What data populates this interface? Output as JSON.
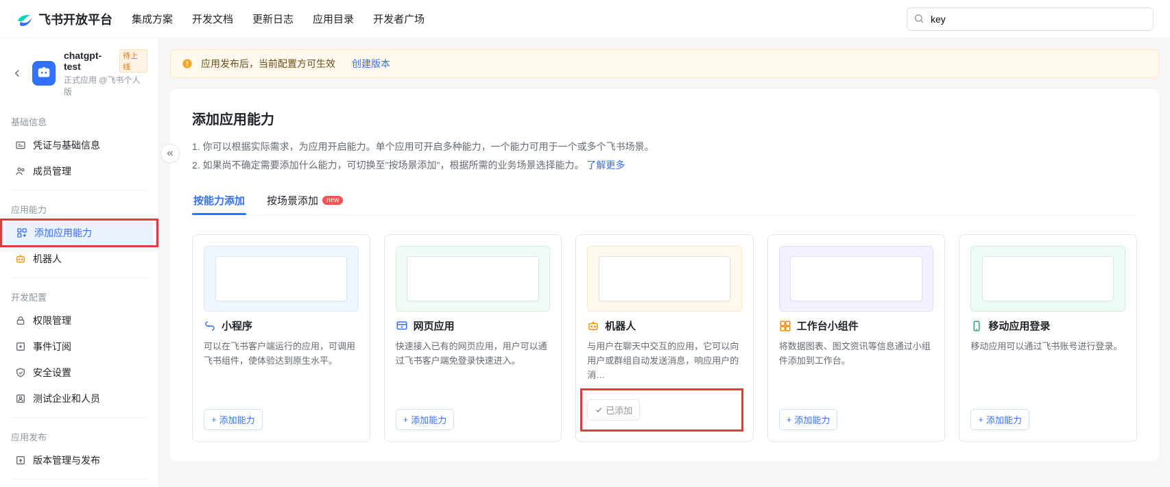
{
  "brand": "飞书开放平台",
  "topnav": [
    "集成方案",
    "开发文档",
    "更新日志",
    "应用目录",
    "开发者广场"
  ],
  "search": {
    "value": "key",
    "placeholder": ""
  },
  "app": {
    "name": "chatgpt-test",
    "status_tag": "待上线",
    "subtitle": "正式应用 @飞书个人版"
  },
  "notice": {
    "text": "应用发布后，当前配置方可生效",
    "action": "创建版本"
  },
  "sidebar": {
    "sections": [
      {
        "title": "基础信息",
        "items": [
          {
            "label": "凭证与基础信息"
          },
          {
            "label": "成员管理"
          }
        ]
      },
      {
        "title": "应用能力",
        "items": [
          {
            "label": "添加应用能力",
            "active": true
          },
          {
            "label": "机器人"
          }
        ]
      },
      {
        "title": "开发配置",
        "items": [
          {
            "label": "权限管理"
          },
          {
            "label": "事件订阅"
          },
          {
            "label": "安全设置"
          },
          {
            "label": "测试企业和人员"
          }
        ]
      },
      {
        "title": "应用发布",
        "items": [
          {
            "label": "版本管理与发布"
          }
        ]
      }
    ]
  },
  "page": {
    "title": "添加应用能力",
    "desc_line1": "1. 你可以根据实际需求，为应用开启能力。单个应用可开启多种能力，一个能力可用于一个或多个飞书场景。",
    "desc_line2_pre": "2. 如果尚不确定需要添加什么能力，可切换至\"按场景添加\"，根据所需的业务场景选择能力。",
    "learn_more": "了解更多"
  },
  "tabs": {
    "items": [
      "按能力添加",
      "按场景添加"
    ],
    "badge": "new",
    "active": 0
  },
  "capabilities": [
    {
      "icon_color": "#3370ff",
      "title": "小程序",
      "desc": "可以在飞书客户端运行的应用，可调用飞书组件，使体验达到原生水平。",
      "btn": "添加能力",
      "added": false,
      "thumb": "blue"
    },
    {
      "icon_color": "#3370ff",
      "title": "网页应用",
      "desc": "快速接入已有的网页应用，用户可以通过飞书客户端免登录快速进入。",
      "btn": "添加能力",
      "added": false,
      "thumb": "green"
    },
    {
      "icon_color": "#f58f00",
      "title": "机器人",
      "desc": "与用户在聊天中交互的应用，它可以向用户或群组自动发送消息，响应用户的消…",
      "btn": "已添加",
      "added": true,
      "thumb": "orange"
    },
    {
      "icon_color": "#f58f00",
      "title": "工作台小组件",
      "desc": "将数据图表、图文资讯等信息通过小组件添加到工作台。",
      "btn": "添加能力",
      "added": false,
      "thumb": "purple"
    },
    {
      "icon_color": "#2ea471",
      "title": "移动应用登录",
      "desc": "移动应用可以通过飞书账号进行登录。",
      "btn": "添加能力",
      "added": false,
      "thumb": "teal"
    }
  ]
}
